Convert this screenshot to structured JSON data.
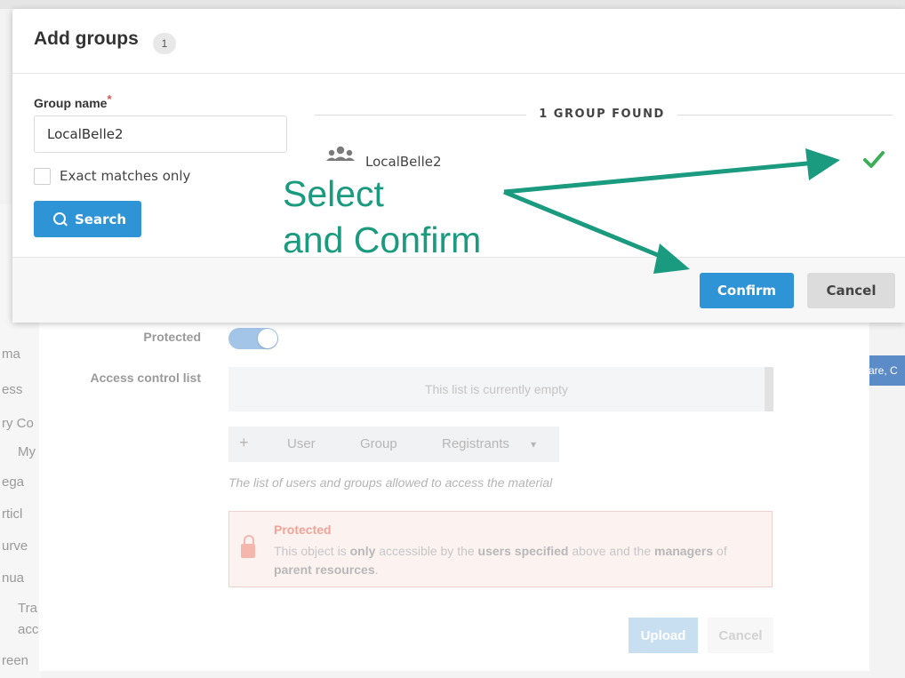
{
  "modal": {
    "title": "Add groups",
    "count": "1",
    "group_name_label": "Group name",
    "required_mark": "*",
    "group_name_value": "LocalBelle2",
    "exact_matches_label": "Exact matches only",
    "search_label": "Search",
    "found_text": "1 GROUP FOUND",
    "result_name": "LocalBelle2",
    "confirm_label": "Confirm",
    "cancel_label": "Cancel"
  },
  "annotation": {
    "line1": "Select",
    "line2": "and Confirm",
    "color": "#1a9a7e"
  },
  "background": {
    "protected_label": "Protected",
    "acl_label": "Access control list",
    "empty_list_text": "This list is currently empty",
    "add_symbol": "+",
    "user_tab": "User",
    "group_tab": "Group",
    "registrants_tab": "Registrants",
    "dropdown_symbol": "▾",
    "hint_text": "The list of users and groups allowed to access the material",
    "alert_title": "Protected",
    "alert_msg_1": "This object is ",
    "alert_msg_only": "only",
    "alert_msg_2": " accessible by the ",
    "alert_msg_users": "users specified",
    "alert_msg_3": " above and the ",
    "alert_msg_managers": "managers",
    "alert_msg_4": " of ",
    "alert_msg_parent": "parent resources",
    "alert_msg_5": ".",
    "upload_label": "Upload",
    "cancel_label": "Cancel",
    "right_chip_text": "are, C",
    "sidebar": [
      "ma",
      "ess",
      "ry Co",
      "My",
      "ega",
      "rticl",
      "urve",
      "nua",
      "Tra",
      "acc",
      "reen"
    ]
  },
  "colors": {
    "primary": "#2f94d6",
    "success_check": "#3cae57",
    "annotation": "#1a9a7e"
  },
  "icons": {
    "search": "search-icon",
    "group": "users-group-icon",
    "check": "check-icon",
    "lock": "lock-icon"
  }
}
